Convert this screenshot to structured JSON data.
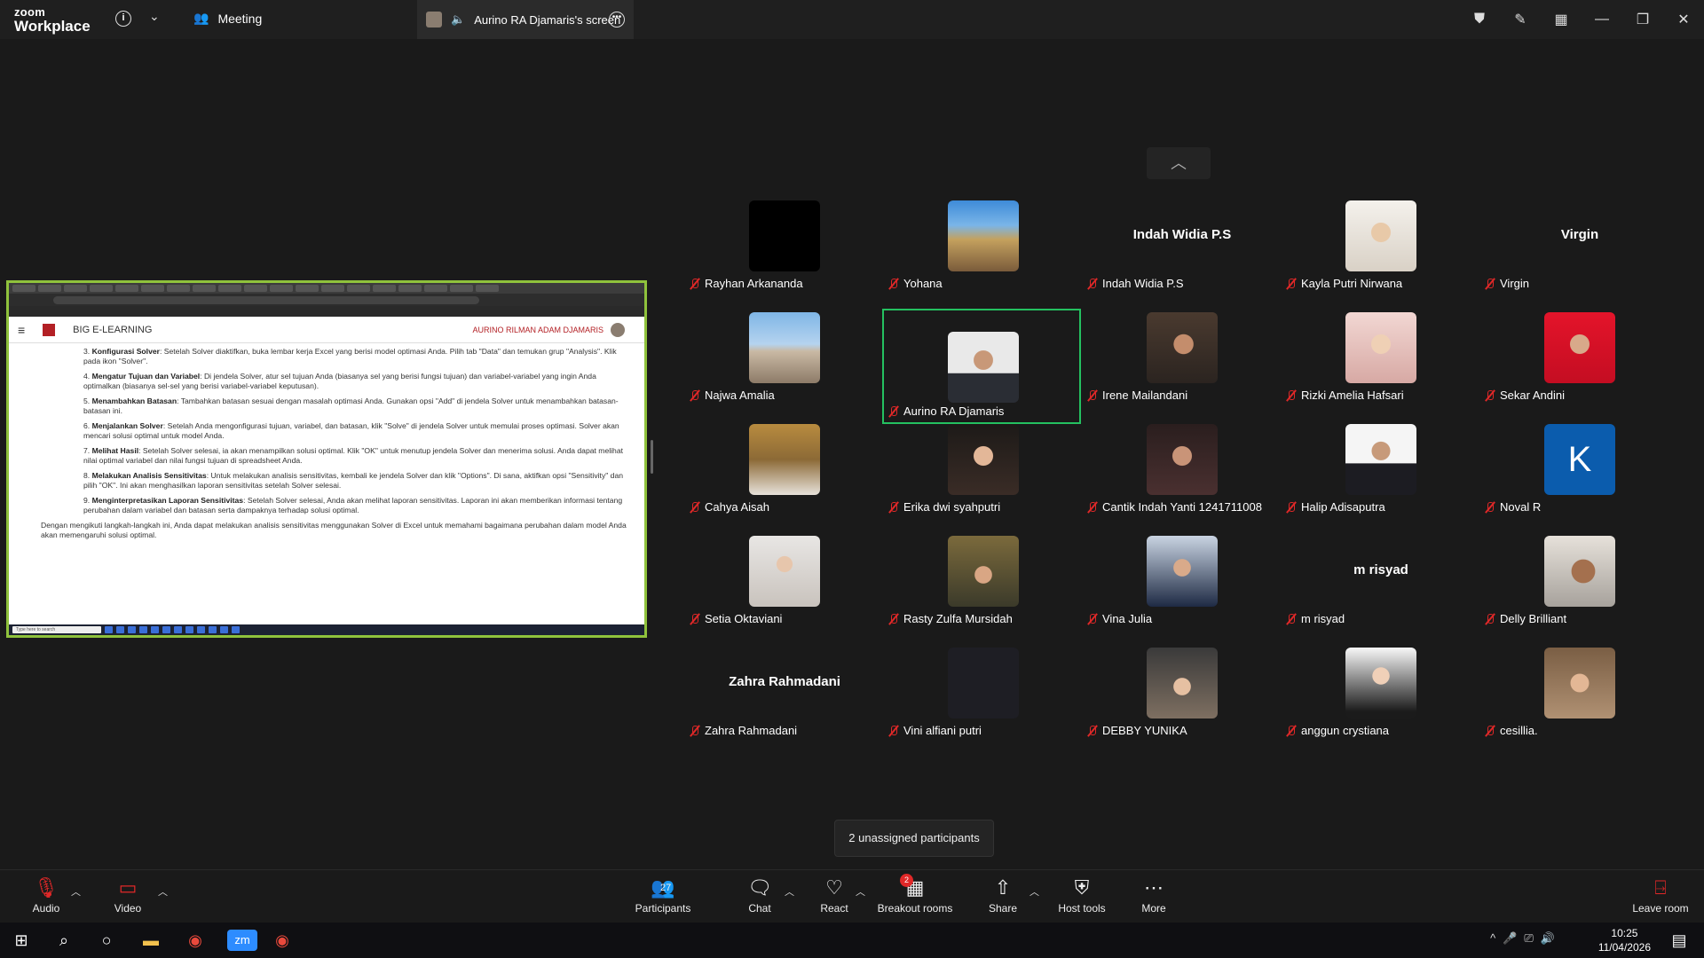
{
  "titlebar": {
    "brand_line1": "zoom",
    "brand_line2": "Workplace",
    "meeting_label": "Meeting",
    "share_tab_label": "Aurino RA Djamaris's screen"
  },
  "shared_screen": {
    "site_title": "BIG E-LEARNING",
    "user_name": "AURINO RILMAN ADAM DJAMARIS",
    "items": [
      {
        "n": "3.",
        "bold": "Konfigurasi Solver",
        "text": ": Setelah Solver diaktifkan, buka lembar kerja Excel yang berisi model optimasi Anda. Pilih tab \"Data\" dan temukan grup \"Analysis\". Klik pada ikon \"Solver\"."
      },
      {
        "n": "4.",
        "bold": "Mengatur Tujuan dan Variabel",
        "text": ": Di jendela Solver, atur sel tujuan Anda (biasanya sel yang berisi fungsi tujuan) dan variabel-variabel yang ingin Anda optimalkan (biasanya sel-sel yang berisi variabel-variabel keputusan)."
      },
      {
        "n": "5.",
        "bold": "Menambahkan Batasan",
        "text": ": Tambahkan batasan sesuai dengan masalah optimasi Anda. Gunakan opsi \"Add\" di jendela Solver untuk menambahkan batasan-batasan ini."
      },
      {
        "n": "6.",
        "bold": "Menjalankan Solver",
        "text": ": Setelah Anda mengonfigurasi tujuan, variabel, dan batasan, klik \"Solve\" di jendela Solver untuk memulai proses optimasi. Solver akan mencari solusi optimal untuk model Anda."
      },
      {
        "n": "7.",
        "bold": "Melihat Hasil",
        "text": ": Setelah Solver selesai, ia akan menampilkan solusi optimal. Klik \"OK\" untuk menutup jendela Solver dan menerima solusi. Anda dapat melihat nilai optimal variabel dan nilai fungsi tujuan di spreadsheet Anda."
      },
      {
        "n": "8.",
        "bold": "Melakukan Analisis Sensitivitas",
        "text": ": Untuk melakukan analisis sensitivitas, kembali ke jendela Solver dan klik \"Options\". Di sana, aktifkan opsi \"Sensitivity\" dan pilih \"OK\". Ini akan menghasilkan laporan sensitivitas setelah Solver selesai."
      },
      {
        "n": "9.",
        "bold": "Menginterpretasikan Laporan Sensitivitas",
        "text": ": Setelah Solver selesai, Anda akan melihat laporan sensitivitas. Laporan ini akan memberikan informasi tentang perubahan dalam variabel dan batasan serta dampaknya terhadap solusi optimal."
      }
    ],
    "closing": "Dengan mengikuti langkah-langkah ini, Anda dapat melakukan analisis sensitivitas menggunakan Solver di Excel untuk memahami bagaimana perubahan dalam model Anda akan memengaruhi solusi optimal.",
    "taskbar_search": "Type here to search"
  },
  "participants": [
    {
      "name": "Rayhan Arkananda",
      "photo": "ph-black"
    },
    {
      "name": "Yohana",
      "photo": "ph-fair"
    },
    {
      "name": "Indah Widia P.S",
      "display": "Indah Widia P.S"
    },
    {
      "name": "Kayla Putri Nirwana",
      "photo": "ph-hijab1"
    },
    {
      "name": "Virgin",
      "display": "Virgin"
    },
    {
      "name": "Najwa Amalia",
      "photo": "ph-temple"
    },
    {
      "name": "Aurino RA Djamaris",
      "photo": "ph-man",
      "active": true
    },
    {
      "name": "Irene Mailandani",
      "photo": "ph-irene"
    },
    {
      "name": "Rizki Amelia Hafsari",
      "photo": "ph-rizki"
    },
    {
      "name": "Sekar Andini",
      "photo": "ph-sekar"
    },
    {
      "name": "Cahya Aisah",
      "photo": "ph-cahya"
    },
    {
      "name": "Erika dwi syahputri",
      "photo": "ph-erika"
    },
    {
      "name": "Cantik Indah Yanti 1241711008",
      "photo": "ph-cantik"
    },
    {
      "name": "Halip Adisaputra",
      "photo": "ph-halip"
    },
    {
      "name": "Noval R",
      "initial": "K"
    },
    {
      "name": "Setia Oktaviani",
      "photo": "ph-setia"
    },
    {
      "name": "Rasty Zulfa Mursidah",
      "photo": "ph-rasty"
    },
    {
      "name": "Vina Julia",
      "photo": "ph-vina"
    },
    {
      "name": "m risyad",
      "display": "m risyad"
    },
    {
      "name": "Delly Brilliant",
      "photo": "ph-delly"
    },
    {
      "name": "Zahra Rahmadani",
      "display": "Zahra Rahmadani"
    },
    {
      "name": "Vini alfiani putri",
      "photo": "ph-vini"
    },
    {
      "name": "DEBBY YUNIKA",
      "photo": "ph-debby"
    },
    {
      "name": "anggun crystiana",
      "photo": "ph-anggun"
    },
    {
      "name": "cesillia.",
      "photo": "ph-cesillia"
    }
  ],
  "unassigned_label": "2 unassigned participants",
  "toolbar": {
    "audio": "Audio",
    "video": "Video",
    "participants": "Participants",
    "participants_count": "27",
    "chat": "Chat",
    "react": "React",
    "breakout": "Breakout rooms",
    "breakout_badge": "2",
    "share": "Share",
    "host_tools": "Host tools",
    "more": "More",
    "leave": "Leave room"
  },
  "taskbar": {
    "time": "10:25",
    "date": "11/04/2026"
  },
  "colors": {
    "accent_green": "#24c160",
    "share_border": "#8fc23c",
    "muted_red": "#e02828"
  }
}
